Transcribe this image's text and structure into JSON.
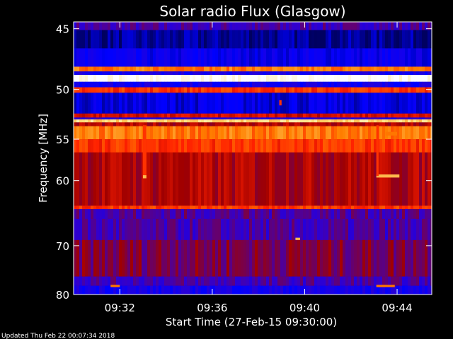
{
  "chart_data": {
    "type": "heatmap",
    "title": "Solar radio Flux (Glasgow)",
    "xlabel": "Start Time (27-Feb-15 09:30:00)",
    "ylabel": "Frequency [MHz]",
    "footer": "Updated Thu Feb 22 00:07:34 2018",
    "x_unit": "minutes after 09:30:00",
    "xlim": [
      0,
      15.5
    ],
    "ylim": [
      80,
      44.5
    ],
    "x_ticks": [
      {
        "value": 2,
        "label": "09:32"
      },
      {
        "value": 6,
        "label": "09:36"
      },
      {
        "value": 10,
        "label": "09:40"
      },
      {
        "value": 14,
        "label": "09:44"
      }
    ],
    "y_ticks": [
      {
        "value": 45,
        "label": "45"
      },
      {
        "value": 50,
        "label": "50"
      },
      {
        "value": 55,
        "label": "55"
      },
      {
        "value": 60,
        "label": "60"
      },
      {
        "value": 70,
        "label": "70"
      },
      {
        "value": 80,
        "label": "80"
      }
    ],
    "y_scale": "nonlinear (reciprocal)",
    "colormap": [
      "#000060",
      "#0000ff",
      "#3300cc",
      "#a00000",
      "#ff2000",
      "#ff8000",
      "#ffe080",
      "#ffffff"
    ],
    "frequency_bands": [
      {
        "from": 44.5,
        "to": 45.1,
        "level": 0.3
      },
      {
        "from": 45.1,
        "to": 46.5,
        "level": 0.05
      },
      {
        "from": 46.5,
        "to": 48.0,
        "level": 0.15
      },
      {
        "from": 48.0,
        "to": 48.4,
        "level": 0.7
      },
      {
        "from": 48.4,
        "to": 48.7,
        "level": 0.2
      },
      {
        "from": 48.7,
        "to": 49.3,
        "level": 1.0
      },
      {
        "from": 49.3,
        "to": 49.8,
        "level": 0.2
      },
      {
        "from": 49.8,
        "to": 50.3,
        "level": 0.6
      },
      {
        "from": 50.3,
        "to": 52.3,
        "level": 0.12
      },
      {
        "from": 52.3,
        "to": 52.7,
        "level": 0.5
      },
      {
        "from": 52.7,
        "to": 52.9,
        "level": 0.25
      },
      {
        "from": 52.9,
        "to": 53.2,
        "level": 0.85
      },
      {
        "from": 53.2,
        "to": 53.6,
        "level": 0.45
      },
      {
        "from": 53.6,
        "to": 55.0,
        "level": 0.7
      },
      {
        "from": 55.0,
        "to": 56.5,
        "level": 0.6
      },
      {
        "from": 56.5,
        "to": 63.5,
        "level": 0.45
      },
      {
        "from": 63.5,
        "to": 64.0,
        "level": 0.6
      },
      {
        "from": 64.0,
        "to": 65.5,
        "level": 0.32
      },
      {
        "from": 65.5,
        "to": 69.0,
        "level": 0.3
      },
      {
        "from": 69.0,
        "to": 76.0,
        "level": 0.38
      },
      {
        "from": 76.0,
        "to": 78.0,
        "level": 0.3
      },
      {
        "from": 78.0,
        "to": 80.0,
        "level": 0.2
      }
    ],
    "events": [
      {
        "t_from": 3.0,
        "t_to": 3.15,
        "f_from": 53.5,
        "f_to": 59.5,
        "level": 0.6
      },
      {
        "t_from": 3.0,
        "t_to": 3.15,
        "f_from": 59.3,
        "f_to": 59.7,
        "level": 0.8
      },
      {
        "t_from": 13.1,
        "t_to": 14.1,
        "f_from": 59.2,
        "f_to": 59.6,
        "level": 0.8
      },
      {
        "t_from": 13.1,
        "t_to": 13.2,
        "f_from": 53.5,
        "f_to": 59.4,
        "level": 0.6
      },
      {
        "t_from": 13.5,
        "t_to": 14.0,
        "f_from": 54.2,
        "f_to": 54.6,
        "level": 0.7
      },
      {
        "t_from": 9.6,
        "t_to": 9.8,
        "f_from": 68.6,
        "f_to": 69.0,
        "level": 0.8
      },
      {
        "t_from": 8.9,
        "t_to": 9.0,
        "f_from": 51.0,
        "f_to": 51.5,
        "level": 0.6
      },
      {
        "t_from": 1.6,
        "t_to": 2.0,
        "f_from": 77.8,
        "f_to": 78.3,
        "level": 0.7
      },
      {
        "t_from": 13.1,
        "t_to": 13.9,
        "f_from": 77.8,
        "f_to": 78.3,
        "level": 0.7
      }
    ]
  }
}
